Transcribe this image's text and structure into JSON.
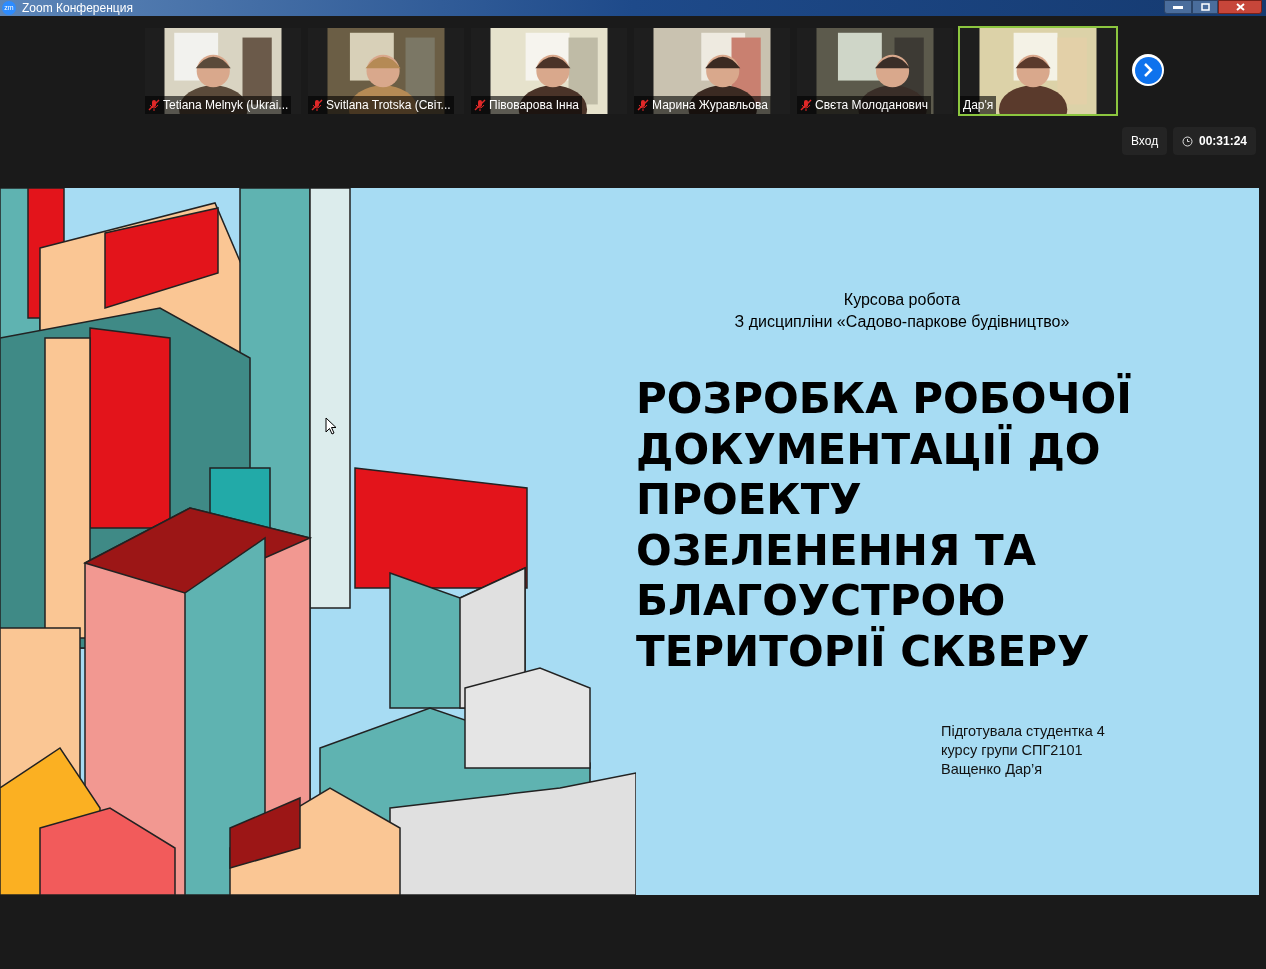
{
  "window": {
    "logo": "zm",
    "title": "Zoom Конференция"
  },
  "participants": [
    {
      "name": "Tetiana Melnyk (Ukrai...",
      "muted": true,
      "selected": false
    },
    {
      "name": "Svitlana Trotska (Світ...",
      "muted": true,
      "selected": false
    },
    {
      "name": "Півоварова Інна",
      "muted": true,
      "selected": false
    },
    {
      "name": "Марина Журавльова",
      "muted": true,
      "selected": false
    },
    {
      "name": "Свєта Молоданович",
      "muted": true,
      "selected": false
    },
    {
      "name": "Дар'я",
      "muted": false,
      "selected": true
    }
  ],
  "controls": {
    "enter_button": "Вход",
    "timer": "00:31:24"
  },
  "slide": {
    "subtitle_lines": [
      "Курсова робота",
      "З дисципліни  «Садово-паркове будівництво»"
    ],
    "title_lines": [
      "РОЗРОБКА РОБОЧОЇ",
      "ДОКУМЕНТАЦІЇ ДО",
      "ПРОЕКТУ",
      "ОЗЕЛЕНЕННЯ ТА",
      "БЛАГОУСТРОЮ",
      "ТЕРИТОРІЇ СКВЕРУ"
    ],
    "author_lines": [
      "Підготувала студентка  4",
      "курсу групи  СПГ2101",
      "Ващенко  Дар’я"
    ]
  }
}
